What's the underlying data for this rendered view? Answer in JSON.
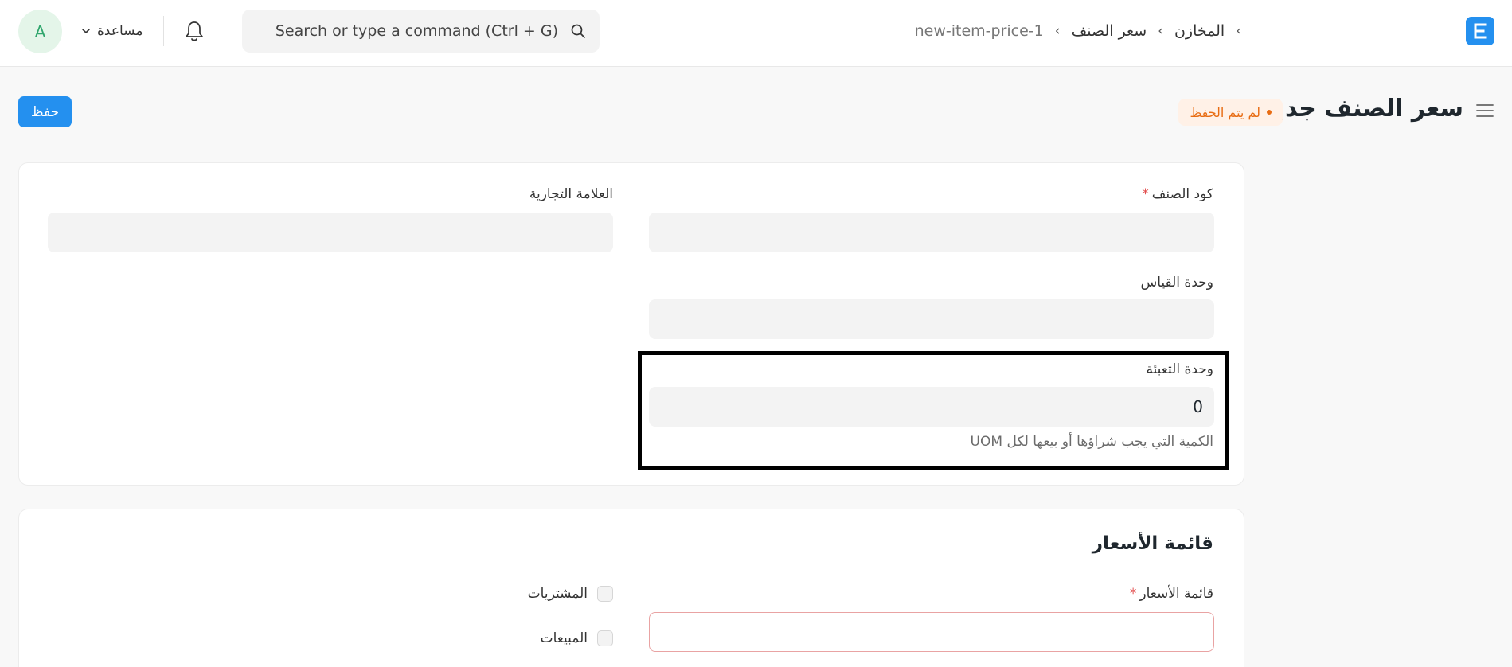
{
  "navbar": {
    "avatar_initial": "A",
    "help_label": "مساعدة",
    "search_placeholder": "Search or type a command (Ctrl + G)",
    "breadcrumbs": [
      "المخازن",
      "سعر الصنف",
      "new-item-price-1"
    ],
    "logo_letter": "E"
  },
  "page": {
    "title": "سعر الصنف جديد",
    "status": "لم يتم الحفظ",
    "save_label": "حفظ"
  },
  "fields": {
    "item_code": {
      "label": "كود الصنف",
      "required_mark": "*",
      "value": ""
    },
    "brand": {
      "label": "العلامة التجارية",
      "value": ""
    },
    "uom": {
      "label": "وحدة القياس",
      "value": ""
    },
    "packing_unit": {
      "label": "وحدة التعبئة",
      "value": "0",
      "description": "الكمية التي يجب شراؤها أو بيعها لكل UOM"
    }
  },
  "price_list_section": {
    "title": "قائمة الأسعار",
    "price_list": {
      "label": "قائمة الأسعار",
      "required_mark": "*",
      "value": ""
    },
    "buying": {
      "label": "المشتريات",
      "checked": false
    },
    "selling": {
      "label": "المبيعات",
      "checked": false
    }
  },
  "colors": {
    "primary": "#2490ef",
    "status_text": "#e86c13",
    "status_bg": "#fff1e7",
    "required": "#e24c4c",
    "avatar_bg": "#e4f5e9",
    "avatar_text": "#30a66d"
  }
}
